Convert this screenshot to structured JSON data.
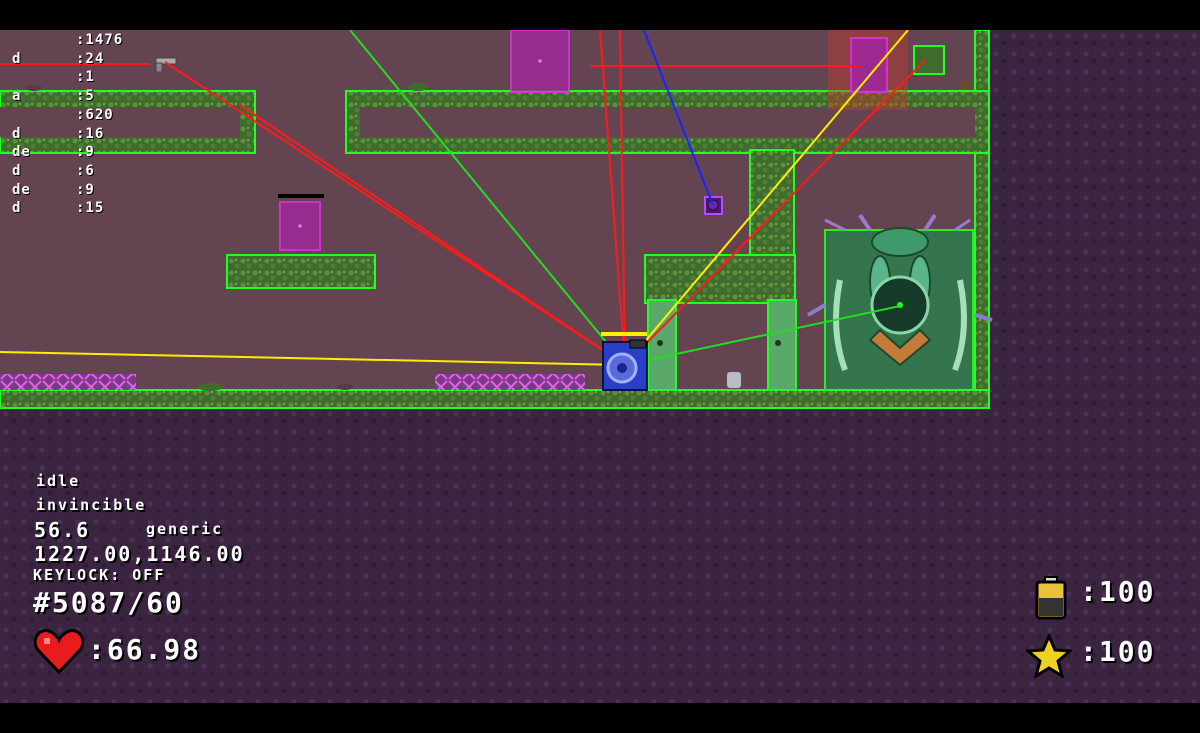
{
  "debug_stats": [
    {
      "key": "",
      "value": ":1476"
    },
    {
      "key": "d",
      "value": ":24"
    },
    {
      "key": "",
      "value": ":1"
    },
    {
      "key": "a",
      "value": ":5"
    },
    {
      "key": "",
      "value": ":620"
    },
    {
      "key": "d",
      "value": ":16"
    },
    {
      "key": "de",
      "value": ":9"
    },
    {
      "key": "d",
      "value": ":6"
    },
    {
      "key": "de",
      "value": ":9"
    },
    {
      "key": "d",
      "value": ":15"
    }
  ],
  "player_status": {
    "state": "idle",
    "mode": "invincible",
    "speed": "56.6",
    "kind": "generic",
    "position": "1227.00,1146.00",
    "keylock": "KEYLOCK: OFF",
    "counter": "#5087/60",
    "health": ":66.98"
  },
  "resources": {
    "battery": ":100",
    "stars": ":100"
  },
  "icons": [
    "pistol-icon",
    "heart-icon",
    "battery-icon",
    "star-icon"
  ],
  "colors": {
    "collision_outline": "#22ff22",
    "ray_red": "#ff1a1a",
    "ray_yellow": "#ffee00",
    "ray_green": "#22dd22",
    "ray_blue": "#1a22ff",
    "trigger_magenta": "#e22ee2",
    "background": "#3a2440"
  }
}
